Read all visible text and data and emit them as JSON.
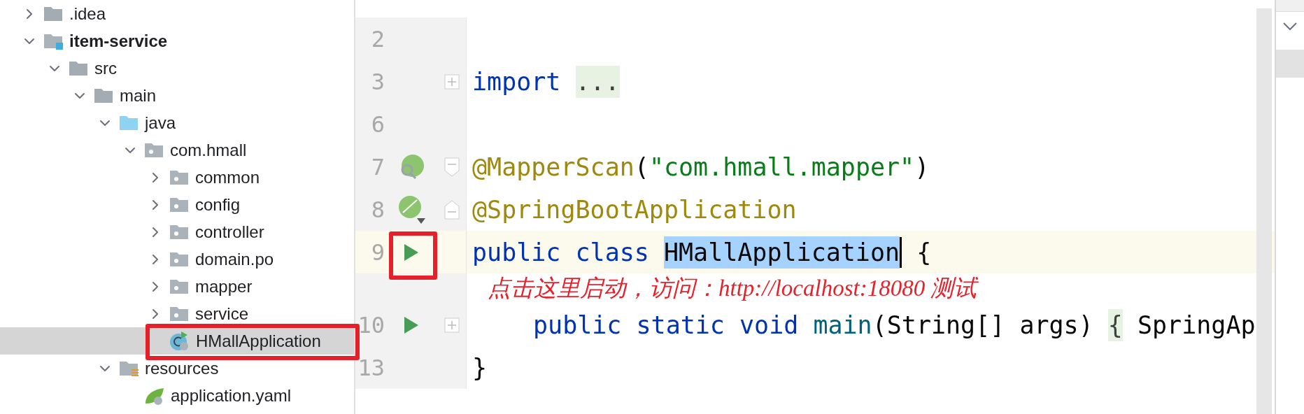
{
  "project_tree": [
    {
      "label": ".idea",
      "kind": "folder",
      "expanded": false,
      "selected": false
    },
    {
      "label": "item-service",
      "kind": "module",
      "expanded": true,
      "selected": false,
      "children": [
        {
          "label": "src",
          "kind": "folder",
          "expanded": true,
          "selected": false,
          "children": [
            {
              "label": "main",
              "kind": "folder",
              "expanded": true,
              "selected": false,
              "children": [
                {
                  "label": "java",
                  "kind": "source-root",
                  "expanded": true,
                  "selected": false,
                  "children": [
                    {
                      "label": "com.hmall",
                      "kind": "package",
                      "expanded": true,
                      "selected": false,
                      "children": [
                        {
                          "label": "common",
                          "kind": "package",
                          "expanded": false,
                          "selected": false
                        },
                        {
                          "label": "config",
                          "kind": "package",
                          "expanded": false,
                          "selected": false
                        },
                        {
                          "label": "controller",
                          "kind": "package",
                          "expanded": false,
                          "selected": false
                        },
                        {
                          "label": "domain.po",
                          "kind": "package",
                          "expanded": false,
                          "selected": false
                        },
                        {
                          "label": "mapper",
                          "kind": "package",
                          "expanded": false,
                          "selected": false
                        },
                        {
                          "label": "service",
                          "kind": "package",
                          "expanded": false,
                          "selected": false
                        },
                        {
                          "label": "HMallApplication",
                          "kind": "spring-class",
                          "selected": true
                        }
                      ]
                    }
                  ]
                },
                {
                  "label": "resources",
                  "kind": "resources-root",
                  "expanded": true,
                  "selected": false,
                  "children": [
                    {
                      "label": "application.yaml",
                      "kind": "spring-config",
                      "selected": false
                    }
                  ]
                }
              ]
            }
          ]
        }
      ]
    }
  ],
  "editor": {
    "lines": [
      {
        "number": "2",
        "current": false
      },
      {
        "number": "3",
        "current": false,
        "fold": {
          "kind": "plus"
        },
        "tokens": [
          {
            "text": "import ",
            "kind": "keyword"
          },
          {
            "text": "...",
            "kind": "folded"
          }
        ]
      },
      {
        "number": "6",
        "current": false
      },
      {
        "number": "7",
        "current": false,
        "gutter": {
          "kind": "bean-search"
        },
        "fold": {
          "kind": "minus"
        },
        "tokens": [
          {
            "text": "@MapperScan",
            "kind": "annotation"
          },
          {
            "text": "(",
            "kind": "plain"
          },
          {
            "text": "\"com.hmall.mapper\"",
            "kind": "string"
          },
          {
            "text": ")",
            "kind": "plain"
          }
        ]
      },
      {
        "number": "8",
        "current": false,
        "gutter": {
          "kind": "bean"
        },
        "fold": {
          "kind": "end"
        },
        "tokens": [
          {
            "text": "@SpringBootApplication",
            "kind": "annotation"
          }
        ]
      },
      {
        "number": "9",
        "current": true,
        "gutter": {
          "kind": "run"
        },
        "tokens": [
          {
            "text": "public class ",
            "kind": "keyword"
          },
          {
            "text": "HMallApplication",
            "kind": "selected",
            "caret": true
          },
          {
            "text": " {",
            "kind": "plain"
          }
        ],
        "note": "点击这里启动，访问：http://localhost:18080 测试"
      },
      {
        "number": "10",
        "current": false,
        "indented": true,
        "gutter": {
          "kind": "run"
        },
        "fold": {
          "kind": "plus"
        },
        "tokens": [
          {
            "text": "public static void ",
            "kind": "keyword"
          },
          {
            "text": "main",
            "kind": "method"
          },
          {
            "text": "(String[] args) ",
            "kind": "plain"
          },
          {
            "text": "{",
            "kind": "folded"
          },
          {
            "text": " SpringAp",
            "kind": "plain"
          }
        ]
      },
      {
        "number": "13",
        "current": false,
        "tokens": [
          {
            "text": "}",
            "kind": "plain"
          }
        ]
      }
    ]
  }
}
